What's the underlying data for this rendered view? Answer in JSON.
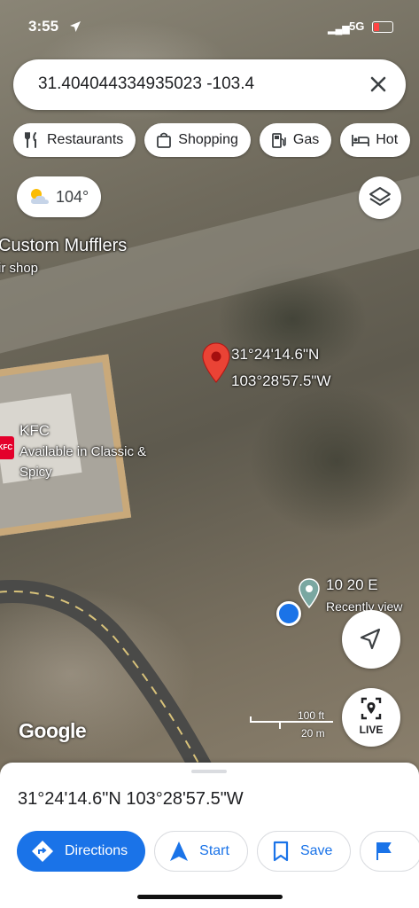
{
  "status_bar": {
    "time": "3:55",
    "network": "5G",
    "battery_color": "#ff3b30"
  },
  "search": {
    "query": "31.404044334935023 -103.4"
  },
  "chips": [
    {
      "label": "Restaurants",
      "icon": "fork-knife-icon"
    },
    {
      "label": "Shopping",
      "icon": "shopping-bag-icon"
    },
    {
      "label": "Gas",
      "icon": "gas-pump-icon"
    },
    {
      "label": "Hot",
      "icon": "bed-icon"
    }
  ],
  "weather": {
    "temperature": "104°",
    "icon": "partly-sunny-icon"
  },
  "map_labels": {
    "business_name": "Custom Mufflers",
    "business_type": "ir shop",
    "pin_lat": "31°24'14.6\"N",
    "pin_lng": "103°28'57.5\"W",
    "kfc_name": "KFC",
    "kfc_logo": "KFC",
    "kfc_note_1": "Available in Classic &",
    "kfc_note_2": "Spicy",
    "recent_title": "10 20 E",
    "recent_sub": "Recently view"
  },
  "scale": {
    "imperial": "100 ft",
    "metric": "20 m"
  },
  "live_label": "LIVE",
  "brand": "Google",
  "place": {
    "coordinates": "31°24'14.6\"N 103°28'57.5\"W"
  },
  "actions": [
    {
      "label": "Directions",
      "icon": "directions-icon",
      "style": "primary"
    },
    {
      "label": "Start",
      "icon": "navigation-arrow-icon",
      "style": "secondary"
    },
    {
      "label": "Save",
      "icon": "bookmark-icon",
      "style": "secondary"
    },
    {
      "label": "",
      "icon": "flag-icon",
      "style": "secondary"
    }
  ],
  "colors": {
    "accent": "#1a73e8",
    "pin": "#ea4335"
  }
}
